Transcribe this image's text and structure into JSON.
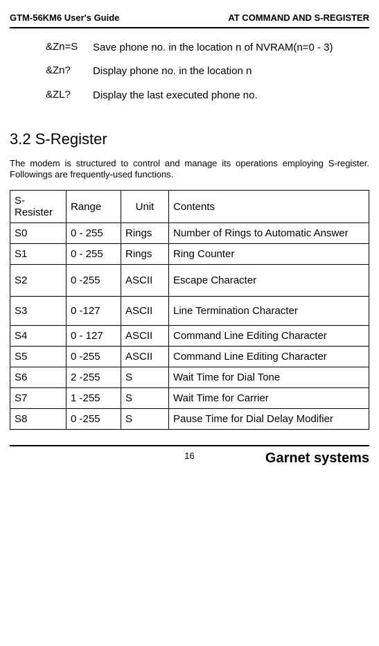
{
  "header": {
    "left": "GTM-56KM6 User's Guide",
    "right": "AT COMMAND  AND S-REGISTER"
  },
  "commands": [
    {
      "key": "&Zn=S",
      "desc": "Save phone no. in the location n of NVRAM(n=0 - 3)"
    },
    {
      "key": "&Zn?",
      "desc": "Display phone no. in the location n"
    },
    {
      "key": "&ZL?",
      "desc": "Display the last executed phone no."
    }
  ],
  "section": {
    "number": "3.2",
    "title": "S-Register"
  },
  "intro": "The modem is structured to control and manage its operations employing S-register. Followings are frequently-used functions.",
  "table": {
    "head": {
      "c0": "S-Resister",
      "c1": "Range",
      "c2": "Unit",
      "c3": "Contents"
    },
    "rows": [
      {
        "c0": "S0",
        "c1": "0 - 255",
        "c2": "Rings",
        "c3": "Number of Rings to Automatic Answer"
      },
      {
        "c0": "S1",
        "c1": "0 - 255",
        "c2": "Rings",
        "c3": "Ring Counter"
      },
      {
        "c0": "S2",
        "c1": "0 -255",
        "c2": "ASCII",
        "c3": "Escape Character"
      },
      {
        "c0": "S3",
        "c1": "0 -127",
        "c2": "ASCII",
        "c3": "Line Termination Character"
      },
      {
        "c0": "S4",
        "c1": "0 - 127",
        "c2": "ASCII",
        "c3": "Command Line Editing Character"
      },
      {
        "c0": "S5",
        "c1": "0 -255",
        "c2": "ASCII",
        "c3": "Command Line Editing Character"
      },
      {
        "c0": "S6",
        "c1": "2 -255",
        "c2": "S",
        "c3": "Wait Time for Dial Tone"
      },
      {
        "c0": "S7",
        "c1": "1 -255",
        "c2": "S",
        "c3": "Wait Time for Carrier"
      },
      {
        "c0": "S8",
        "c1": "0 -255",
        "c2": "S",
        "c3": "Pause Time for Dial Delay Modifier"
      }
    ]
  },
  "footer": {
    "page": "16",
    "brand": "Garnet systems"
  }
}
